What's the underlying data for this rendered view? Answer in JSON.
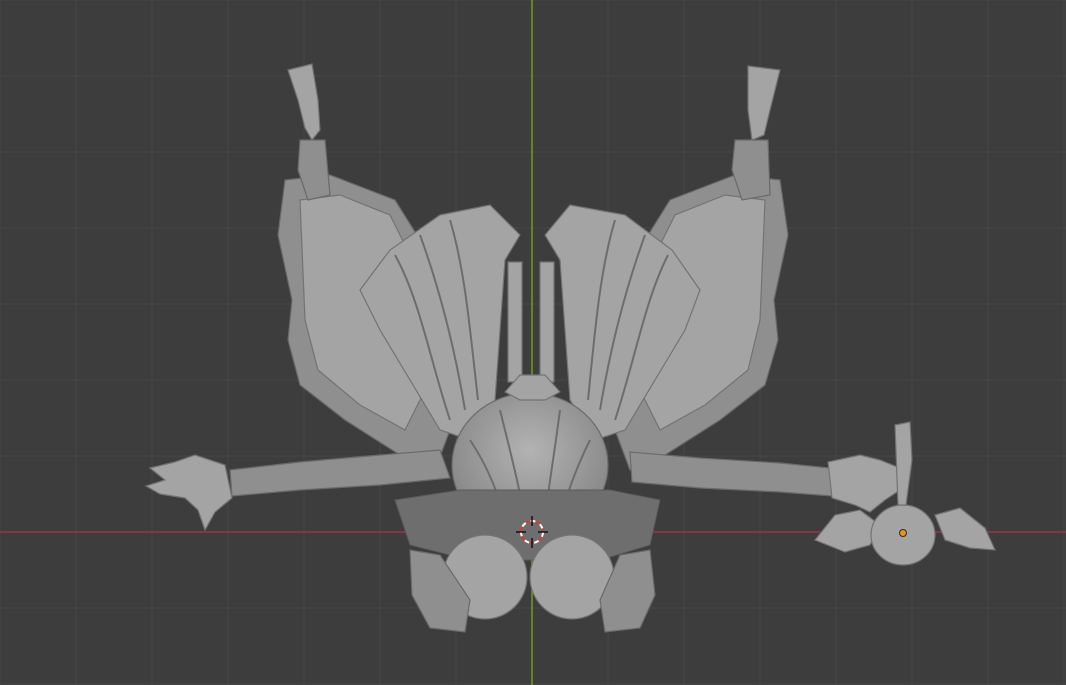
{
  "viewport": {
    "background_color": "#3d3d3d",
    "grid_color": "#474747",
    "x_axis_color": "#9e3346",
    "y_axis_color": "#6f9e1d",
    "model_color": "#9a9a9a",
    "origin_dot_color": "#e8931f",
    "cursor_colors": [
      "#d63a3a",
      "#ffffff"
    ],
    "objects": [
      {
        "name": "character-model",
        "icon": "mesh-object"
      },
      {
        "name": "bird-model",
        "icon": "mesh-object"
      },
      {
        "name": "3d-cursor",
        "icon": "3d-cursor-icon"
      }
    ]
  }
}
